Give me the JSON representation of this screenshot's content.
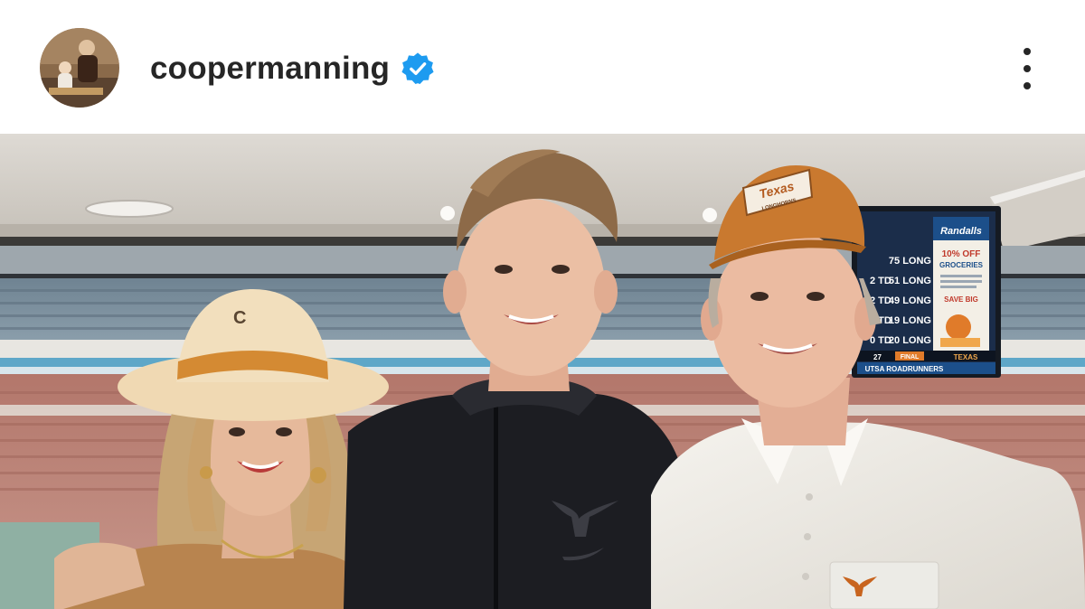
{
  "post": {
    "username": "coopermanning",
    "verified": true,
    "avatar_icon": "profile-avatar",
    "verified_icon": "verified-badge-icon",
    "more_icon": "more-options-icon",
    "colors": {
      "verified_blue": "#1d9bf0",
      "text_primary": "#262626",
      "background": "#ffffff"
    }
  },
  "photo": {
    "cap_text": "Texas",
    "cap_subtext": "LONGHORNS",
    "hat_letter": "C",
    "scoreboard": {
      "sponsor": "Randalls",
      "promo_line1": "10% OFF",
      "promo_line2": "GROCERIES",
      "promo_line3": "SAVE BIG",
      "rows": [
        {
          "down": "",
          "yards": "75 LONG"
        },
        {
          "down": "2 TD",
          "yards": "51 LONG"
        },
        {
          "down": "2 TD",
          "yards": "49 LONG"
        },
        {
          "down": "2 TD",
          "yards": "19 LONG"
        },
        {
          "down": "0 TD",
          "yards": "20 LONG"
        }
      ],
      "ticker_score": "27",
      "ticker_final": "FINAL",
      "ticker_team": "TEXAS",
      "ticker_bottom": "UTSA ROADRUNNERS"
    }
  }
}
